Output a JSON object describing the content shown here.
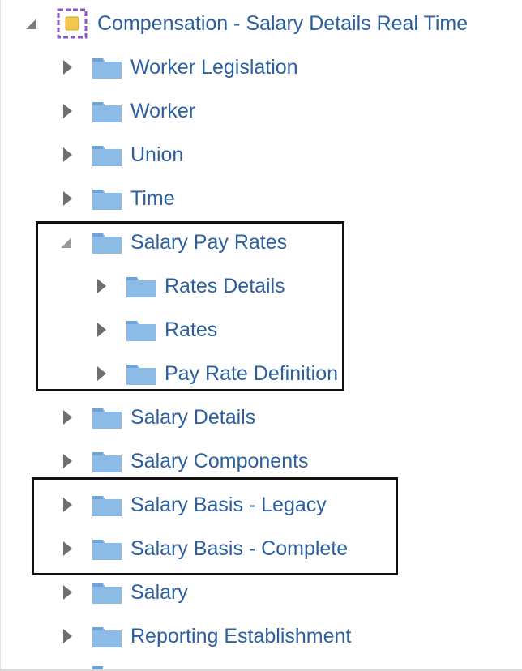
{
  "tree": {
    "root": {
      "label": "Compensation - Salary Details Real Time",
      "icon": "subject-area-icon",
      "expanded": true
    },
    "items": [
      {
        "label": "Worker Legislation",
        "expanded": false
      },
      {
        "label": "Worker",
        "expanded": false
      },
      {
        "label": "Union",
        "expanded": false
      },
      {
        "label": "Time",
        "expanded": false
      },
      {
        "label": "Salary Pay Rates",
        "expanded": true,
        "children": [
          {
            "label": "Rates Details",
            "expanded": false
          },
          {
            "label": "Rates",
            "expanded": false
          },
          {
            "label": "Pay Rate Definition",
            "expanded": false
          }
        ]
      },
      {
        "label": "Salary Details",
        "expanded": false
      },
      {
        "label": "Salary Components",
        "expanded": false
      },
      {
        "label": "Salary Basis - Legacy",
        "expanded": false
      },
      {
        "label": "Salary Basis - Complete",
        "expanded": false
      },
      {
        "label": "Salary",
        "expanded": false
      },
      {
        "label": "Reporting Establishment",
        "expanded": false
      }
    ]
  },
  "colors": {
    "label": "#2b5f9e",
    "folder": "#8cbbe8",
    "folder_dark": "#6fa4d8",
    "toggle": "#6f6f6f",
    "highlight_border": "#111111"
  }
}
